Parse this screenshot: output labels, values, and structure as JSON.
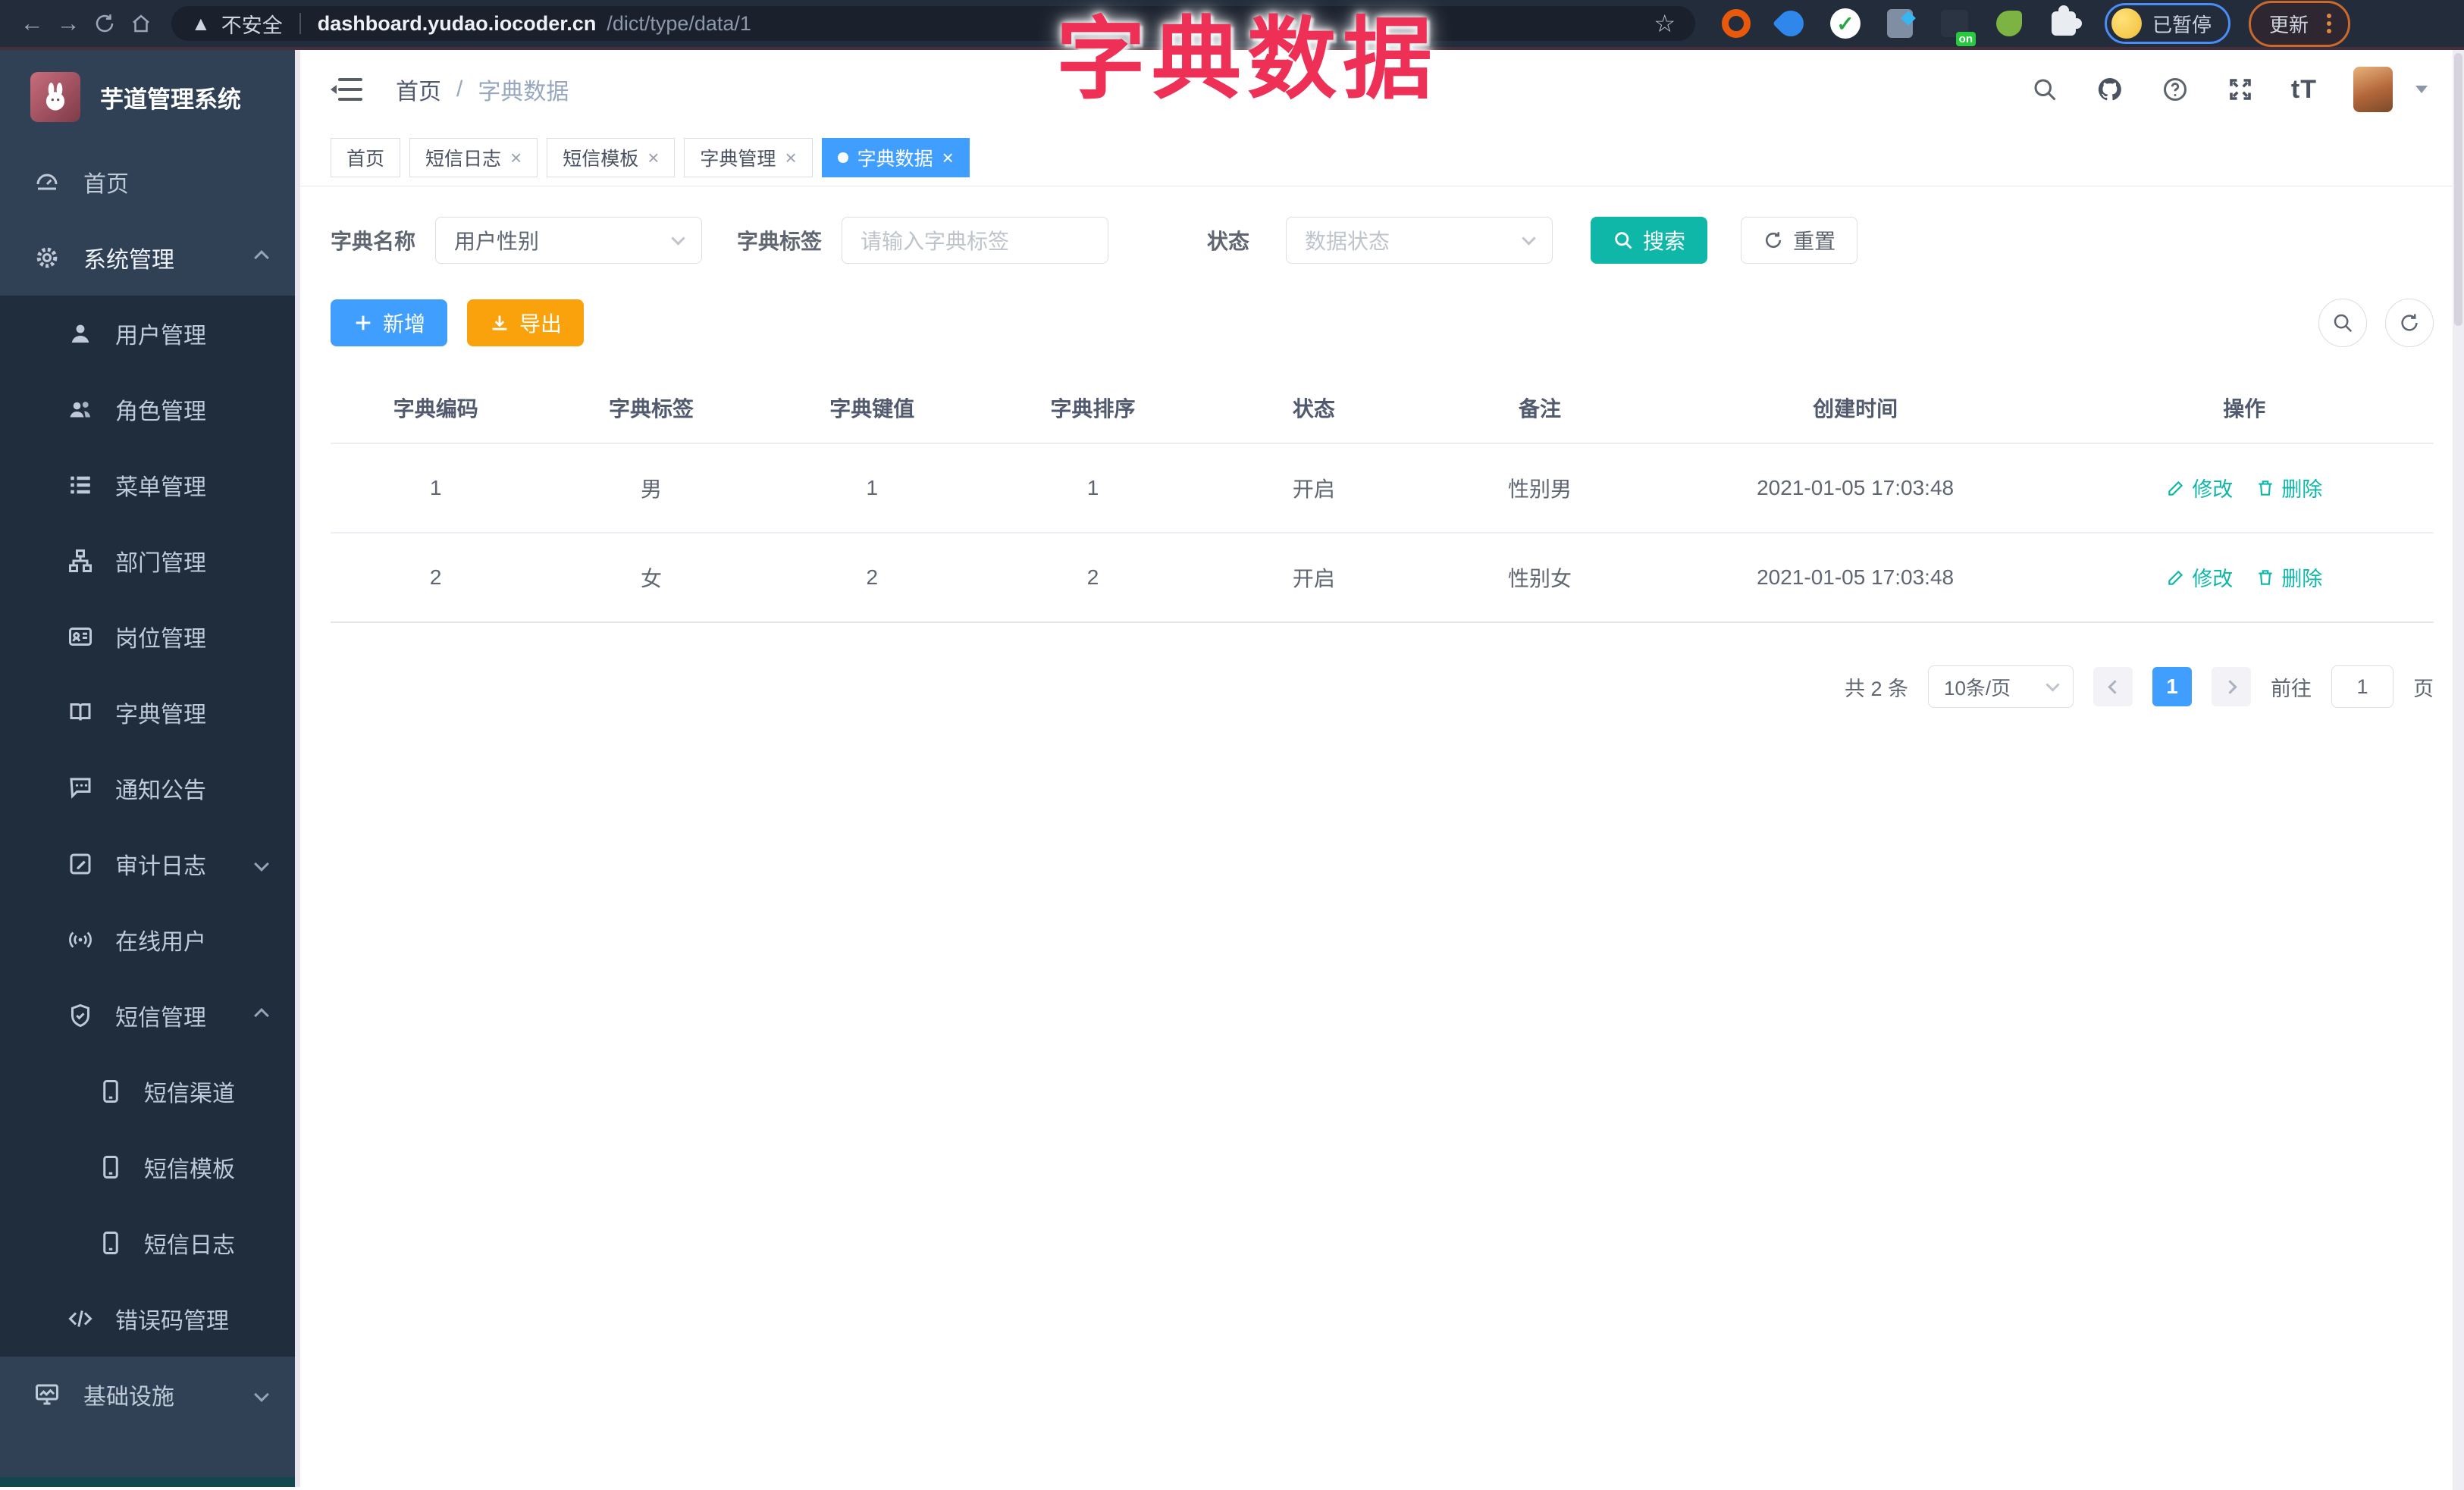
{
  "browser": {
    "security_label": "不安全",
    "url_domain": "dashboard.yudao.iocoder.cn",
    "url_path": "/dict/type/data/1",
    "ext_badge": "on",
    "profile_status": "已暂停",
    "update_label": "更新"
  },
  "overlay_title": "字典数据",
  "colors": {
    "primary_blue": "#409eff",
    "theme_teal": "#0fb7a8",
    "export_orange": "#f9a20c",
    "overlay_pink": "#ee2f56",
    "sidebar_bg": "#304156",
    "sidebar_submenu_bg": "#1f2d3d",
    "chrome_bg": "#222c3a"
  },
  "sidebar": {
    "logo_title": "芋道管理系统",
    "items": [
      {
        "name": "home",
        "label": "首页",
        "icon": "dashboard-icon",
        "level": "root"
      },
      {
        "name": "system-management",
        "label": "系统管理",
        "icon": "gear-icon",
        "level": "root",
        "arrow": "up",
        "active": true
      },
      {
        "name": "user-management",
        "label": "用户管理",
        "icon": "user-icon",
        "level": "sub"
      },
      {
        "name": "role-management",
        "label": "角色管理",
        "icon": "users-icon",
        "level": "sub"
      },
      {
        "name": "menu-management",
        "label": "菜单管理",
        "icon": "menu-list-icon",
        "level": "sub"
      },
      {
        "name": "dept-management",
        "label": "部门管理",
        "icon": "org-tree-icon",
        "level": "sub"
      },
      {
        "name": "post-management",
        "label": "岗位管理",
        "icon": "id-card-icon",
        "level": "sub"
      },
      {
        "name": "dict-management",
        "label": "字典管理",
        "icon": "book-icon",
        "level": "sub"
      },
      {
        "name": "notice-announcement",
        "label": "通知公告",
        "icon": "message-bubble-icon",
        "level": "sub"
      },
      {
        "name": "audit-log",
        "label": "审计日志",
        "icon": "edit-log-icon",
        "level": "sub",
        "arrow": "down"
      },
      {
        "name": "online-users",
        "label": "在线用户",
        "icon": "online-signal-icon",
        "level": "sub"
      },
      {
        "name": "sms-management",
        "label": "短信管理",
        "icon": "shield-check-icon",
        "level": "sub",
        "arrow": "up"
      },
      {
        "name": "sms-channel",
        "label": "短信渠道",
        "icon": "phone-icon",
        "level": "subsub"
      },
      {
        "name": "sms-template",
        "label": "短信模板",
        "icon": "phone-icon",
        "level": "subsub"
      },
      {
        "name": "sms-log",
        "label": "短信日志",
        "icon": "phone-icon",
        "level": "subsub"
      },
      {
        "name": "error-code-management",
        "label": "错误码管理",
        "icon": "code-icon",
        "level": "sub"
      },
      {
        "name": "infrastructure",
        "label": "基础设施",
        "icon": "monitor-icon",
        "level": "root",
        "arrow": "down"
      }
    ]
  },
  "header": {
    "breadcrumb": {
      "home": "首页",
      "separator": "/",
      "current": "字典数据"
    }
  },
  "tabs": [
    {
      "name": "home",
      "label": "首页",
      "closable": false,
      "active": false
    },
    {
      "name": "sms-log",
      "label": "短信日志",
      "closable": true,
      "active": false
    },
    {
      "name": "sms-template",
      "label": "短信模板",
      "closable": true,
      "active": false
    },
    {
      "name": "dict-management",
      "label": "字典管理",
      "closable": true,
      "active": false
    },
    {
      "name": "dict-data",
      "label": "字典数据",
      "closable": true,
      "active": true
    }
  ],
  "filters": {
    "dict_name": {
      "label": "字典名称",
      "value": "用户性别"
    },
    "dict_label": {
      "label": "字典标签",
      "placeholder": "请输入字典标签"
    },
    "status": {
      "label": "状态",
      "placeholder": "数据状态"
    },
    "search_label": "搜索",
    "reset_label": "重置"
  },
  "toolbar": {
    "add_label": "新增",
    "export_label": "导出"
  },
  "table": {
    "columns": [
      "字典编码",
      "字典标签",
      "字典键值",
      "字典排序",
      "状态",
      "备注",
      "创建时间",
      "操作"
    ],
    "rows": [
      [
        "1",
        "男",
        "1",
        "1",
        "开启",
        "性别男",
        "2021-01-05 17:03:48"
      ],
      [
        "2",
        "女",
        "2",
        "2",
        "开启",
        "性别女",
        "2021-01-05 17:03:48"
      ]
    ],
    "actions": {
      "edit": "修改",
      "delete": "删除"
    }
  },
  "pagination": {
    "total": "共 2 条",
    "page_size": "10条/页",
    "current_page": "1",
    "goto_label": "前往",
    "goto_value": "1",
    "page_unit": "页"
  }
}
